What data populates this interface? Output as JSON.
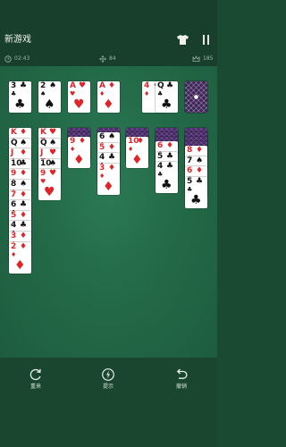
{
  "header": {
    "title": "新游戏"
  },
  "stats": {
    "time": "02:43",
    "moves": "84",
    "score": "185"
  },
  "foundations": [
    {
      "rank": "3",
      "suit": "♣",
      "color": "black"
    },
    {
      "rank": "2",
      "suit": "♠",
      "color": "black"
    },
    {
      "rank": "A",
      "suit": "♥",
      "color": "red"
    },
    {
      "rank": "A",
      "suit": "♦",
      "color": "red"
    }
  ],
  "waste": [
    {
      "rank": "4",
      "suit": "♦",
      "color": "red"
    },
    {
      "rank": "Q",
      "suit": "♣",
      "color": "black"
    }
  ],
  "tableau": [
    {
      "hidden": 0,
      "cards": [
        {
          "rank": "K",
          "suit": "♦",
          "color": "red"
        },
        {
          "rank": "Q",
          "suit": "♠",
          "color": "black"
        },
        {
          "rank": "J",
          "suit": "♦",
          "color": "red"
        },
        {
          "rank": "10",
          "suit": "♣",
          "color": "black"
        },
        {
          "rank": "9",
          "suit": "♦",
          "color": "red"
        },
        {
          "rank": "8",
          "suit": "♠",
          "color": "black"
        },
        {
          "rank": "7",
          "suit": "♦",
          "color": "red"
        },
        {
          "rank": "6",
          "suit": "♣",
          "color": "black"
        },
        {
          "rank": "5",
          "suit": "♦",
          "color": "red"
        },
        {
          "rank": "4",
          "suit": "♣",
          "color": "black"
        },
        {
          "rank": "3",
          "suit": "♦",
          "color": "red"
        },
        {
          "rank": "2",
          "suit": "♦",
          "color": "red"
        }
      ]
    },
    {
      "hidden": 0,
      "cards": [
        {
          "rank": "K",
          "suit": "♥",
          "color": "red"
        },
        {
          "rank": "Q",
          "suit": "♠",
          "color": "black"
        },
        {
          "rank": "J",
          "suit": "♥",
          "color": "red"
        },
        {
          "rank": "10",
          "suit": "♠",
          "color": "black"
        },
        {
          "rank": "9",
          "suit": "♥",
          "color": "red"
        }
      ]
    },
    {
      "hidden": 2,
      "cards": [
        {
          "rank": "9",
          "suit": "♦",
          "color": "red"
        }
      ]
    },
    {
      "hidden": 1,
      "cards": [
        {
          "rank": "6",
          "suit": "♠",
          "color": "black"
        },
        {
          "rank": "5",
          "suit": "♦",
          "color": "red"
        },
        {
          "rank": "4",
          "suit": "♣",
          "color": "black"
        },
        {
          "rank": "3",
          "suit": "♦",
          "color": "red"
        }
      ]
    },
    {
      "hidden": 2,
      "cards": [
        {
          "rank": "10",
          "suit": "♦",
          "color": "red"
        }
      ]
    },
    {
      "hidden": 3,
      "cards": [
        {
          "rank": "6",
          "suit": "♦",
          "color": "red"
        },
        {
          "rank": "5",
          "suit": "♣",
          "color": "black"
        },
        {
          "rank": "4",
          "suit": "♣",
          "color": "black"
        }
      ]
    },
    {
      "hidden": 4,
      "cards": [
        {
          "rank": "8",
          "suit": "♦",
          "color": "red"
        },
        {
          "rank": "7",
          "suit": "♠",
          "color": "black"
        },
        {
          "rank": "6",
          "suit": "♦",
          "color": "red"
        },
        {
          "rank": "5",
          "suit": "♣",
          "color": "black"
        }
      ]
    }
  ],
  "actions": {
    "restart": "重来",
    "hint": "提示",
    "undo": "撤销"
  },
  "colors": {
    "felt": "#236a48",
    "card_back": "#4a2a6a",
    "red_suit": "#e0242a"
  }
}
